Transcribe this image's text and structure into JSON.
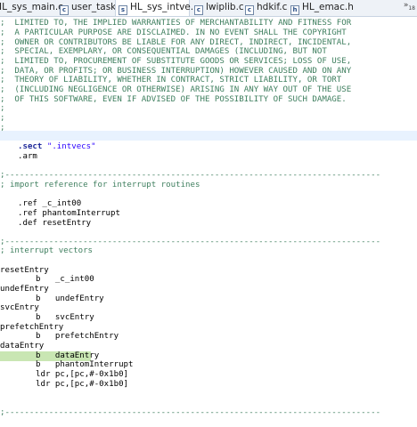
{
  "tabs": [
    {
      "label": "IL_sys_main.c",
      "active": false
    },
    {
      "label": "user_task.c",
      "active": false
    },
    {
      "label": "HL_sys_intve...",
      "active": true
    },
    {
      "label": "lwiplib.c",
      "active": false
    },
    {
      "label": "hdkif.c",
      "active": false
    },
    {
      "label": "HL_emac.h",
      "active": false
    }
  ],
  "tab_overflow": {
    "symbol": "»",
    "count": "18"
  },
  "code": {
    "l1": ";  LIMITED TO, THE IMPLIED WARRANTIES OF MERCHANTABILITY AND FITNESS FOR",
    "l2": ";  A PARTICULAR PURPOSE ARE DISCLAIMED. IN NO EVENT SHALL THE COPYRIGHT",
    "l3": ";  OWNER OR CONTRIBUTORS BE LIABLE FOR ANY DIRECT, INDIRECT, INCIDENTAL,",
    "l4": ";  SPECIAL, EXEMPLARY, OR CONSEQUENTIAL DAMAGES (INCLUDING, BUT NOT",
    "l5": ";  LIMITED TO, PROCUREMENT OF SUBSTITUTE GOODS OR SERVICES; LOSS OF USE,",
    "l6": ";  DATA, OR PROFITS; OR BUSINESS INTERRUPTION) HOWEVER CAUSED AND ON ANY",
    "l7": ";  THEORY OF LIABILITY, WHETHER IN CONTRACT, STRICT LIABILITY, OR TORT",
    "l8": ";  (INCLUDING NEGLIGENCE OR OTHERWISE) ARISING IN ANY WAY OUT OF THE USE",
    "l9": ";  OF THIS SOFTWARE, EVEN IF ADVISED OF THE POSSIBILITY OF SUCH DAMAGE.",
    "l10": ";",
    "l11": ";",
    "l12": ";",
    "sect_kw": ".sect",
    "sect_str": "\".intvecs\"",
    "arm": ".arm",
    "sep": ";-----------------------------------------------------------------------------",
    "import_comment": "; import reference for interrupt routines",
    "ref1": ".ref _c_int00",
    "ref2": ".ref phantomInterrupt",
    "def1": ".def resetEntry",
    "vectors_comment": "; interrupt vectors",
    "resetEntry": "resetEntry",
    "b_c_int00": "b   _c_int00",
    "undefEntry": "undefEntry",
    "b_undefEntry": "b   undefEntry",
    "svcEntry": "svcEntry",
    "b_svcEntry": "b   svcEntry",
    "prefetchEntry": "prefetchEntry",
    "b_prefetchEntry": "b   prefetchEntry",
    "dataEntry": "dataEntry",
    "b_dataEntry": "b   dataEntry",
    "b_phantom": "b   phantomInterrupt",
    "ldr1": "ldr pc,[pc,#-0x1b0]",
    "ldr2": "ldr pc,[pc,#-0x1b0]"
  },
  "colors": {
    "comment": "#3f7f5f",
    "keyword": "#1f2a9a",
    "string": "#2a00ff",
    "highlight": "#c9e6b3",
    "cursor_line": "#e8f2fe"
  }
}
